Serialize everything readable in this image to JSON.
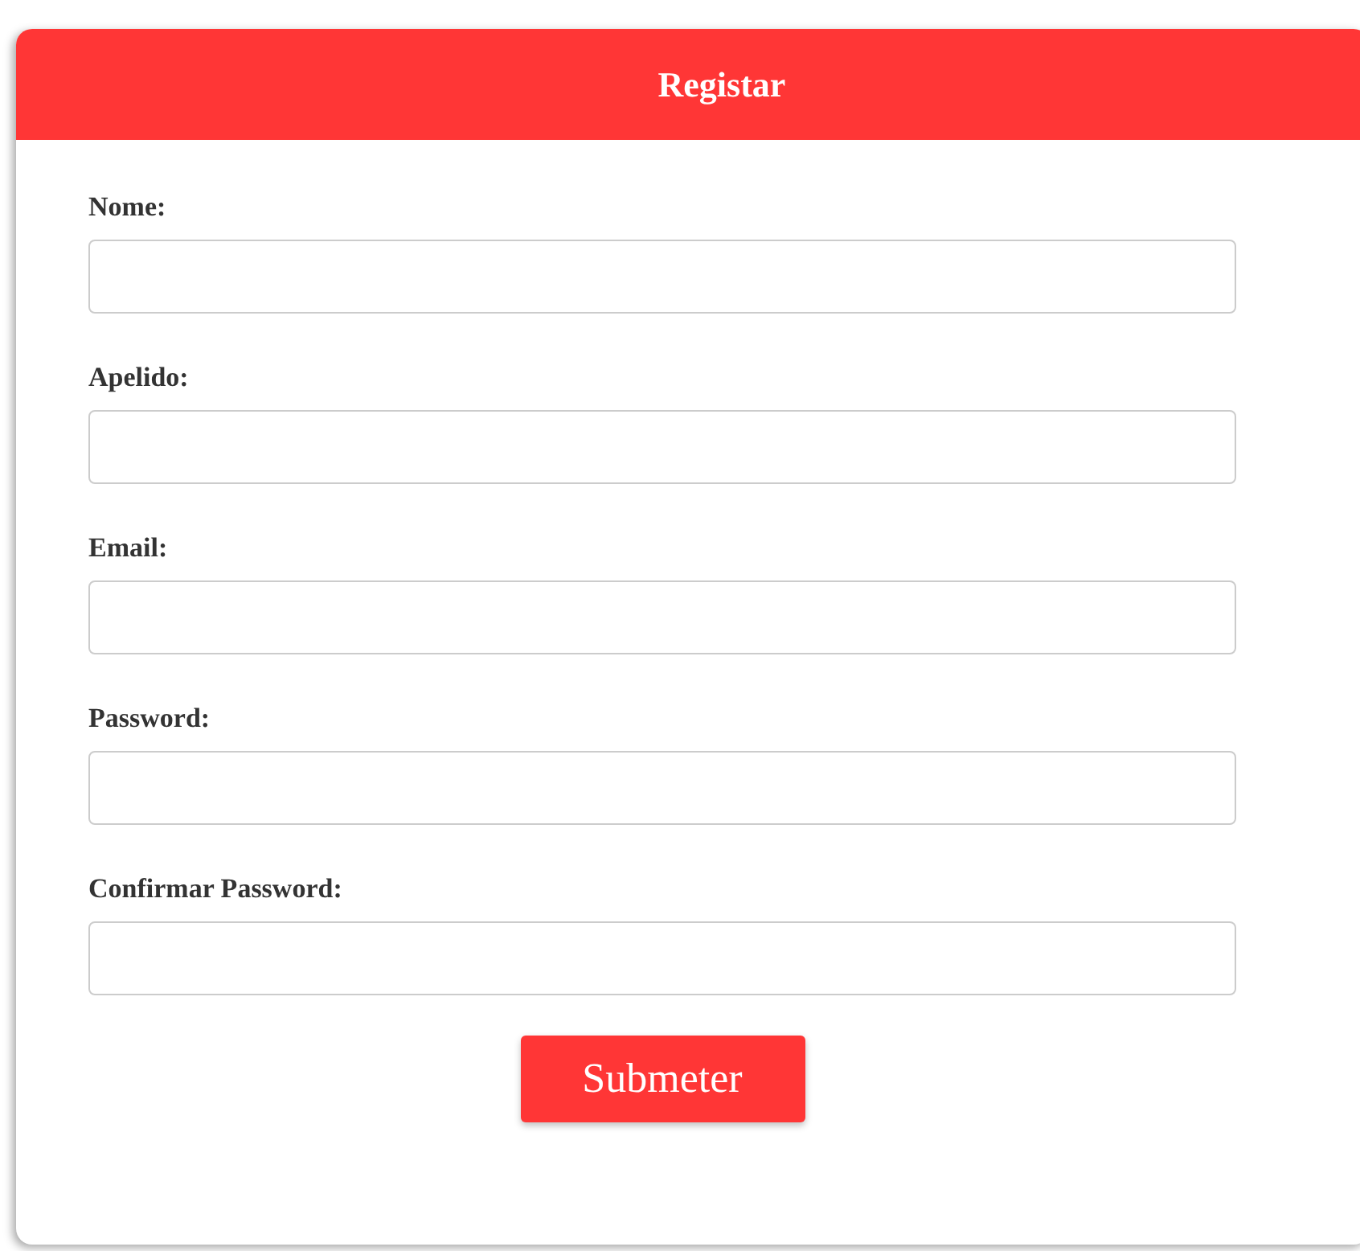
{
  "form": {
    "title": "Registar",
    "fields": [
      {
        "label": "Nome:"
      },
      {
        "label": "Apelido:"
      },
      {
        "label": "Email:"
      },
      {
        "label": "Password:"
      },
      {
        "label": "Confirmar Password:"
      }
    ],
    "submit": "Submeter"
  }
}
